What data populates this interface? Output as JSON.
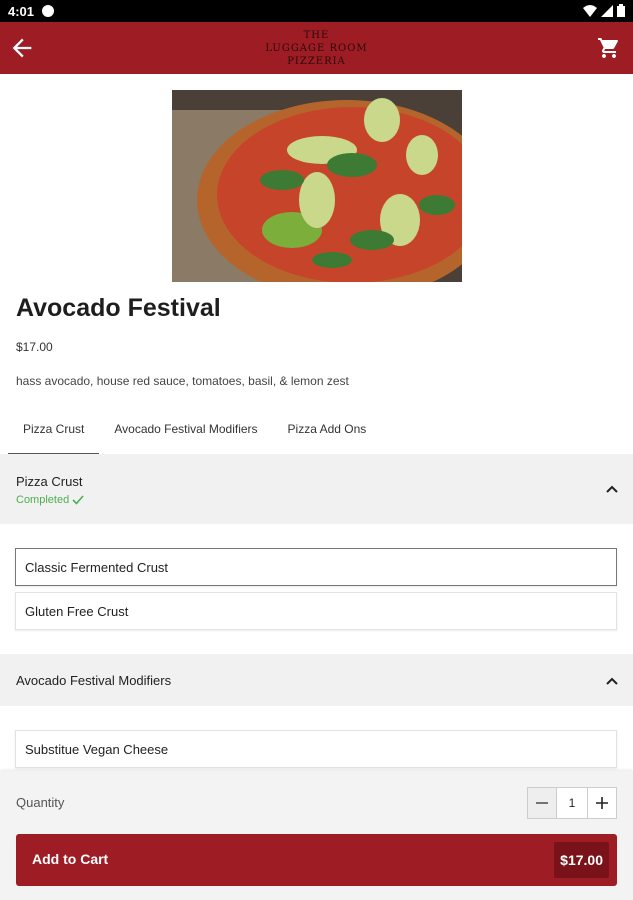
{
  "status_bar": {
    "time": "4:01"
  },
  "app_bar": {
    "logo_line1": "THE",
    "logo_line2": "LUGGAGE ROOM",
    "logo_line3": "PIZZERIA"
  },
  "product": {
    "name": "Avocado Festival",
    "price": "$17.00",
    "description": "hass avocado, house red sauce, tomatoes, basil, & lemon zest"
  },
  "tabs": [
    {
      "label": "Pizza Crust",
      "active": true
    },
    {
      "label": "Avocado Festival Modifiers",
      "active": false
    },
    {
      "label": "Pizza Add Ons",
      "active": false
    }
  ],
  "sections": [
    {
      "title": "Pizza Crust",
      "status": "Completed",
      "options": [
        "Classic Fermented Crust",
        "Gluten Free Crust"
      ],
      "selected": "Classic Fermented Crust"
    },
    {
      "title": "Avocado Festival Modifiers",
      "options": [
        "Substitue Vegan Cheese"
      ]
    }
  ],
  "quantity": {
    "label": "Quantity",
    "value": "1"
  },
  "add_to_cart": {
    "label": "Add to Cart",
    "amount": "$17.00"
  },
  "colors": {
    "brand": "#9e1c24",
    "completed": "#4caf50"
  }
}
